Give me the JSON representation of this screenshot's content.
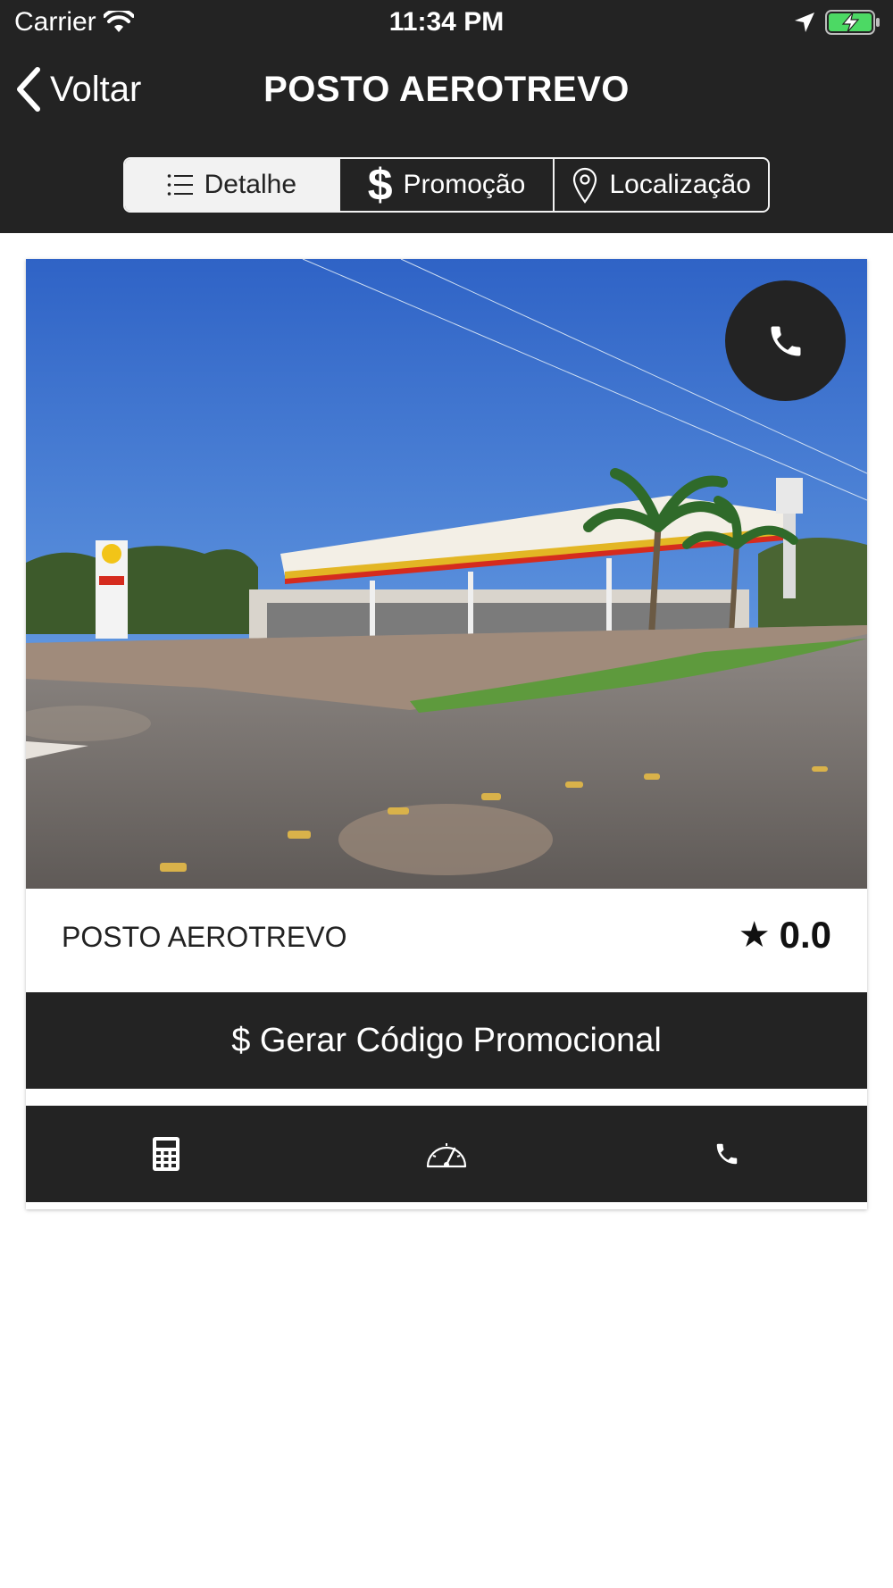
{
  "status_bar": {
    "carrier": "Carrier",
    "time": "11:34 PM",
    "icons": [
      "wifi-icon",
      "location-arrow-icon",
      "battery-charging-icon"
    ]
  },
  "nav": {
    "back_label": "Voltar",
    "title": "POSTO AEROTREVO"
  },
  "tabs": [
    {
      "label": "Detalhe",
      "icon": "list-icon",
      "active": true
    },
    {
      "label": "Promoção",
      "icon": "$",
      "active": false
    },
    {
      "label": "Localização",
      "icon": "map-pin-icon",
      "active": false
    }
  ],
  "station": {
    "name": "POSTO AEROTREVO",
    "rating_star": "★",
    "rating": "0.0",
    "photo_icon": "gas-station-photo"
  },
  "promo_button": {
    "label": "$ Gerar Código Promocional"
  },
  "actions": [
    {
      "icon": "calculator-icon"
    },
    {
      "icon": "speedometer-icon"
    },
    {
      "icon": "phone-icon"
    }
  ],
  "colors": {
    "dark": "#232323",
    "light": "#f2f2f2",
    "white": "#ffffff"
  }
}
